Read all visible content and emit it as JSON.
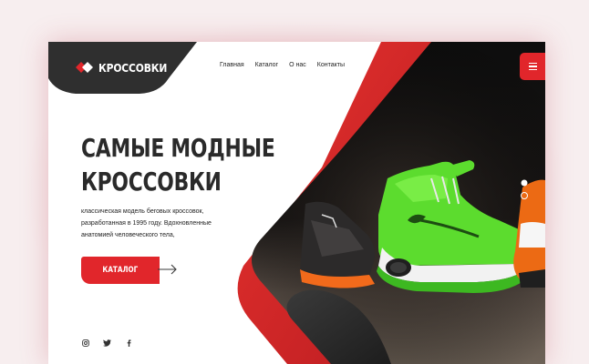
{
  "brand": {
    "name": "КРОССОВКИ"
  },
  "nav": {
    "items": [
      {
        "label": "Главная"
      },
      {
        "label": "Каталог"
      },
      {
        "label": "О нас"
      },
      {
        "label": "Контакты"
      }
    ]
  },
  "hero": {
    "title_line1": "САМЫЕ МОДНЫЕ",
    "title_line2": "КРОССОВКИ",
    "description_line1": "классическая модель беговых кроссовок,",
    "description_line2": "разработанная в 1995 году. Вдохновленные",
    "description_line3": "анатомией человеческого тела,",
    "cta_label": "КАТАЛОГ"
  },
  "slider": {
    "total": 2,
    "active": 1
  },
  "colors": {
    "accent": "#e1262b",
    "dark": "#2f2f2f",
    "text": "#2a2a2a",
    "background": "#f7eeef"
  },
  "icons": [
    "logo-mark-icon",
    "menu-icon",
    "arrow-right-icon",
    "instagram-icon",
    "twitter-icon",
    "facebook-icon"
  ]
}
